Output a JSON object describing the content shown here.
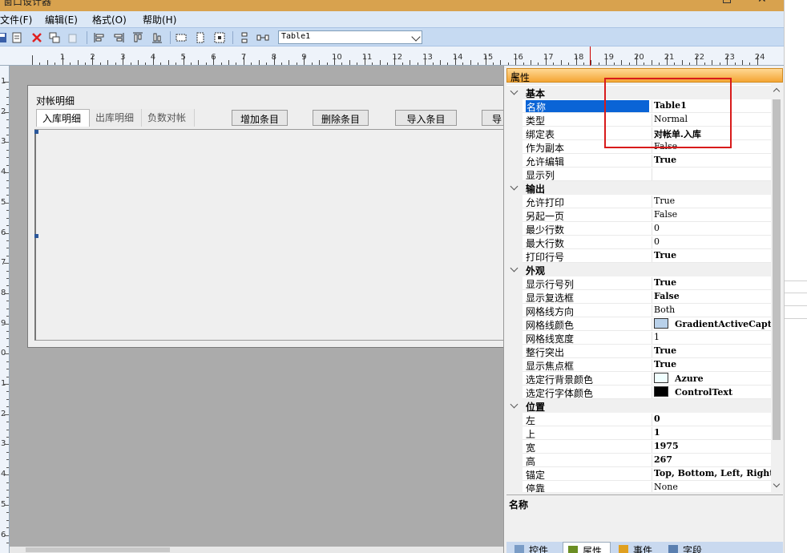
{
  "window": {
    "title": "窗口设计器"
  },
  "menu": [
    "文件(F)",
    "编辑(E)",
    "格式(O)",
    "帮助(H)"
  ],
  "toolbar": {
    "object_combo": "Table1"
  },
  "ruler": {
    "labels": [
      "1",
      "2",
      "3",
      "4",
      "5",
      "6",
      "7",
      "8",
      "9",
      "10",
      "11",
      "12",
      "13",
      "14",
      "15",
      "16",
      "17",
      "18",
      "19",
      "20",
      "21",
      "22",
      "23",
      "24"
    ]
  },
  "vruler": {
    "labels": [
      "1",
      "2",
      "3",
      "4",
      "5",
      "6",
      "7",
      "8",
      "9",
      "0",
      "1",
      "2",
      "3",
      "4",
      "5",
      "6"
    ]
  },
  "form": {
    "title": "对帐明细",
    "tabs": [
      "入库明细",
      "出库明细",
      "负数对帐"
    ],
    "buttons": [
      "增加条目",
      "删除条目",
      "导入条目",
      "导"
    ]
  },
  "panel": {
    "title": "属性",
    "pin_icon": "pin-icon",
    "categories": [
      {
        "name": "基本",
        "rows": [
          {
            "label": "名称",
            "value": "Table1",
            "bold": true
          },
          {
            "label": "类型",
            "value": "Normal",
            "bold": false
          },
          {
            "label": "绑定表",
            "value": "对帐单.入库",
            "bold": true
          },
          {
            "label": "作为副本",
            "value": "False",
            "bold": false
          },
          {
            "label": "允许编辑",
            "value": "True",
            "bold": true
          },
          {
            "label": "显示列",
            "value": "",
            "bold": false
          }
        ]
      },
      {
        "name": "输出",
        "rows": [
          {
            "label": "允许打印",
            "value": "True",
            "bold": false
          },
          {
            "label": "另起一页",
            "value": "False",
            "bold": false
          },
          {
            "label": "最少行数",
            "value": "0",
            "bold": false
          },
          {
            "label": "最大行数",
            "value": "0",
            "bold": false
          },
          {
            "label": "打印行号",
            "value": "True",
            "bold": true
          }
        ]
      },
      {
        "name": "外观",
        "rows": [
          {
            "label": "显示行号列",
            "value": "True",
            "bold": true
          },
          {
            "label": "显示复选框",
            "value": "False",
            "bold": true
          },
          {
            "label": "网格线方向",
            "value": "Both",
            "bold": false
          },
          {
            "label": "网格线颜色",
            "value": "GradientActiveCaption",
            "bold": true,
            "swatch": "#b9d1ea"
          },
          {
            "label": "网格线宽度",
            "value": "1",
            "bold": false
          },
          {
            "label": "整行突出",
            "value": "True",
            "bold": true
          },
          {
            "label": "显示焦点框",
            "value": "True",
            "bold": true
          },
          {
            "label": "选定行背景颜色",
            "value": "Azure",
            "bold": true,
            "swatch": "#f0ffff"
          },
          {
            "label": "选定行字体颜色",
            "value": "ControlText",
            "bold": true,
            "swatch": "#000000"
          }
        ]
      },
      {
        "name": "位置",
        "rows": [
          {
            "label": "左",
            "value": "0",
            "bold": true
          },
          {
            "label": "上",
            "value": "1",
            "bold": true
          },
          {
            "label": "宽",
            "value": "1975",
            "bold": true
          },
          {
            "label": "高",
            "value": "267",
            "bold": true
          },
          {
            "label": "锚定",
            "value": "Top, Bottom, Left, Right",
            "bold": true
          },
          {
            "label": "停靠",
            "value": "None",
            "bold": false
          }
        ]
      }
    ],
    "description_title": "名称",
    "bottom_tabs": [
      {
        "label": "控件",
        "icon": "controls-icon"
      },
      {
        "label": "属性",
        "icon": "properties-icon"
      },
      {
        "label": "事件",
        "icon": "events-icon"
      },
      {
        "label": "字段",
        "icon": "fields-icon"
      }
    ]
  },
  "colors": {
    "accent": "#d81b1b",
    "selection": "#0a64d6",
    "panel_header": "#f4a534"
  }
}
